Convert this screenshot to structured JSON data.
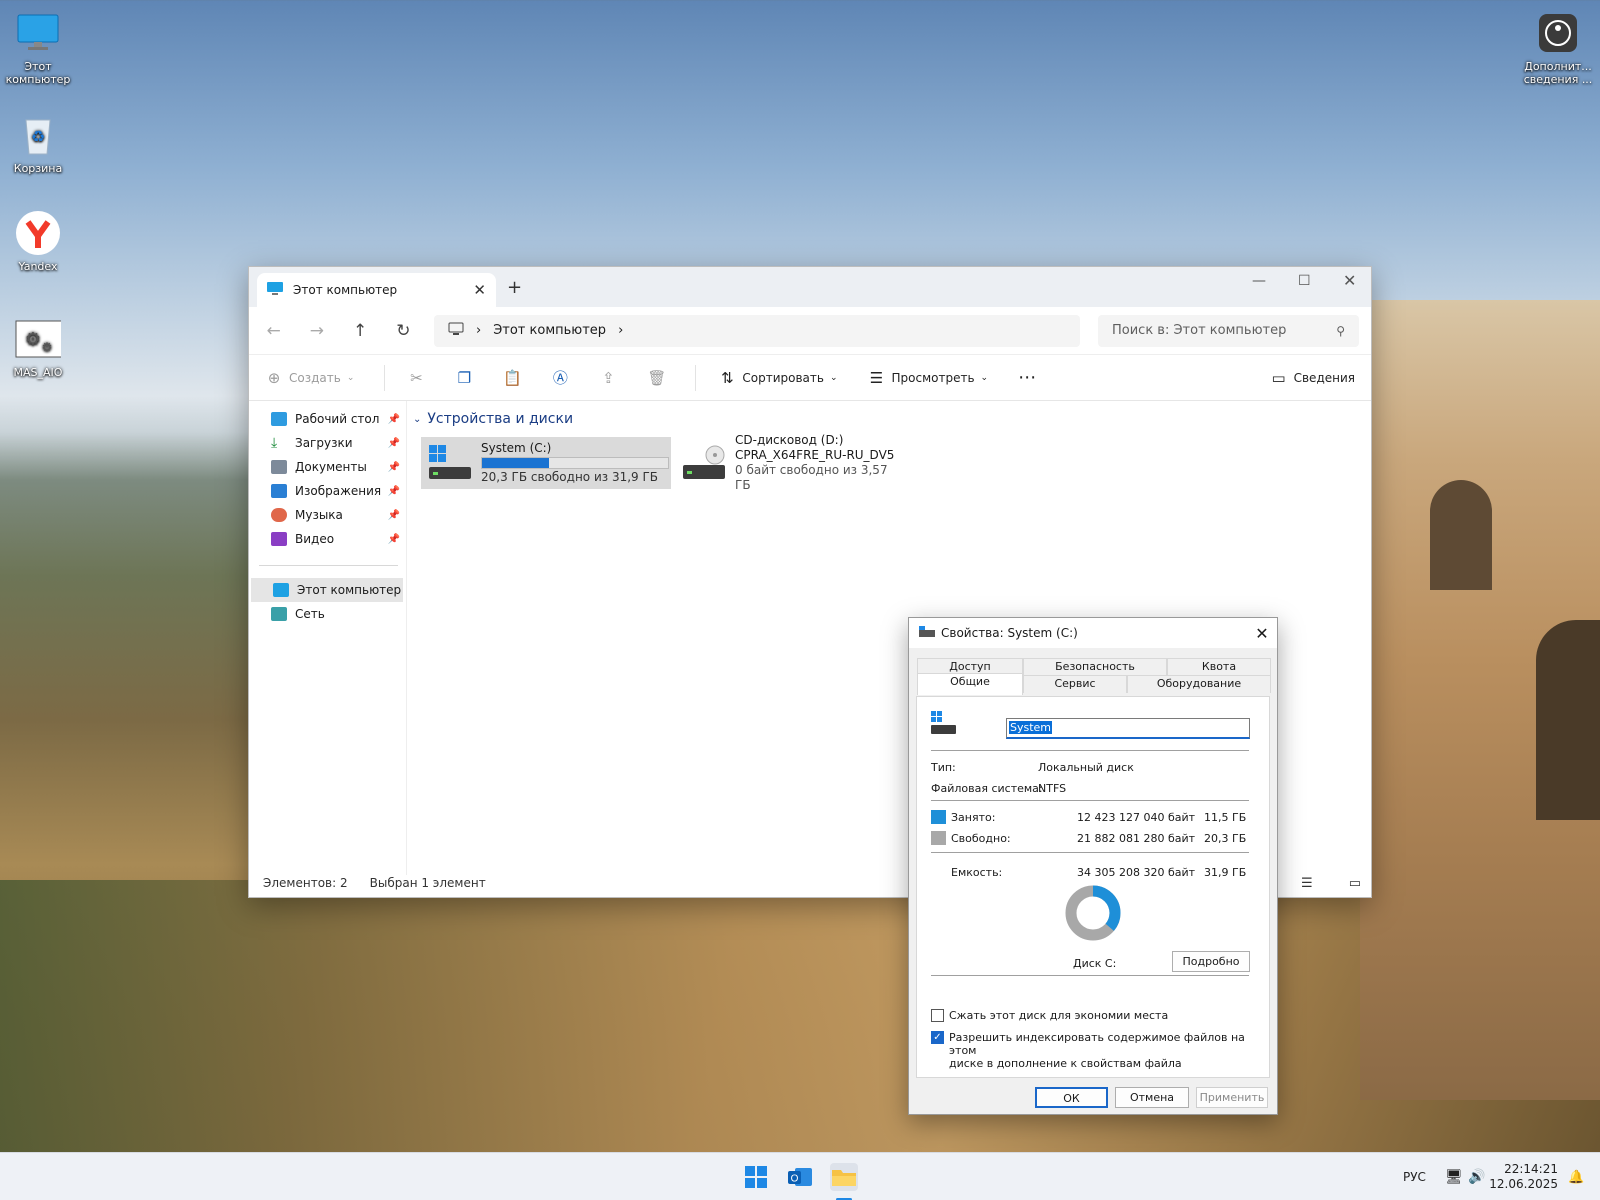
{
  "desktop": {
    "icons": [
      {
        "label": "Этот компьютер",
        "icon": "monitor-icon"
      },
      {
        "label": "Корзина",
        "icon": "recycle-bin-icon"
      },
      {
        "label": "Yandex",
        "icon": "yandex-browser-icon"
      },
      {
        "label": "MAS_AIO",
        "icon": "gear-script-icon"
      },
      {
        "label": "Дополнит... сведения ...",
        "icon": "info-circle-icon"
      }
    ]
  },
  "explorer": {
    "tab_title": "Этот компьютер",
    "breadcrumb": [
      "Этот компьютер"
    ],
    "search_placeholder": "Поиск в: Этот компьютер",
    "commands": {
      "new": "Создать",
      "sort": "Сортировать",
      "view": "Просмотреть",
      "details": "Сведения"
    },
    "sidebar": {
      "quick": [
        "Рабочий стол",
        "Загрузки",
        "Документы",
        "Изображения",
        "Музыка",
        "Видео"
      ],
      "places": [
        "Этот компьютер",
        "Сеть"
      ]
    },
    "group_title": "Устройства и диски",
    "drives": [
      {
        "name": "System (C:)",
        "free_text": "20,3 ГБ свободно из 31,9 ГБ",
        "used_fraction": 0.36
      },
      {
        "name": "CD-дисковод (D:)",
        "label": "CPRA_X64FRE_RU-RU_DV5",
        "free_text": "0 байт свободно из 3,57 ГБ"
      }
    ],
    "status": {
      "items": "Элементов: 2",
      "selected": "Выбран 1 элемент"
    }
  },
  "dialog": {
    "title": "Свойства: System (C:)",
    "tabs_row1": [
      "Доступ",
      "Безопасность",
      "Квота"
    ],
    "tabs_row2": [
      "Общие",
      "Сервис",
      "Оборудование"
    ],
    "active_tab": "Общие",
    "volume_label": "System",
    "type_label": "Тип:",
    "type_value": "Локальный диск",
    "fs_label": "Файловая система:",
    "fs_value": "NTFS",
    "used": {
      "label": "Занято:",
      "bytes": "12 423 127 040 байт",
      "gb": "11,5 ГБ"
    },
    "free": {
      "label": "Свободно:",
      "bytes": "21 882 081 280 байт",
      "gb": "20,3 ГБ"
    },
    "capacity": {
      "label": "Емкость:",
      "bytes": "34 305 208 320 байт",
      "gb": "31,9 ГБ"
    },
    "used_fraction": 0.362,
    "disk_caption": "Диск C:",
    "details_button": "Подробно",
    "compress_label": "Сжать этот диск для экономии места",
    "compress_checked": false,
    "index_label_1": "Разрешить индексировать содержимое файлов на этом",
    "index_label_2": "диске в дополнение к свойствам файла",
    "index_checked": true,
    "buttons": {
      "ok": "ОК",
      "cancel": "Отмена",
      "apply": "Применить"
    },
    "colors": {
      "used": "#1e8fd8",
      "free": "#a8a8a8"
    }
  },
  "taskbar": {
    "language": "РУС",
    "time": "22:14:21",
    "date": "12.06.2025"
  }
}
